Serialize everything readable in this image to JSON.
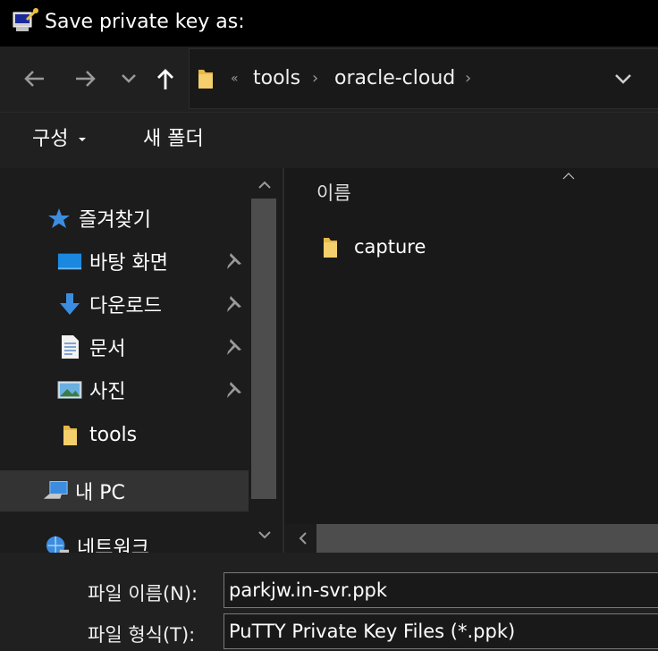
{
  "window": {
    "title": "Save private key as:",
    "app_icon": "putty-keygen-icon"
  },
  "nav": {
    "back_icon": "arrow-left-icon",
    "forward_icon": "arrow-right-icon",
    "recent_icon": "chevron-down-icon",
    "up_icon": "arrow-up-icon"
  },
  "address": {
    "overflow": "«",
    "crumbs": [
      "tools",
      "oracle-cloud"
    ],
    "separator": "›"
  },
  "commands": {
    "organize": "구성",
    "new_folder": "새 폴더"
  },
  "sidebar": {
    "items": [
      {
        "label": "즐겨찾기",
        "icon": "star-icon"
      },
      {
        "label": "바탕 화면",
        "icon": "desktop-icon",
        "pinned": true
      },
      {
        "label": "다운로드",
        "icon": "download-icon",
        "pinned": true
      },
      {
        "label": "문서",
        "icon": "document-icon",
        "pinned": true
      },
      {
        "label": "사진",
        "icon": "pictures-icon",
        "pinned": true
      },
      {
        "label": "tools",
        "icon": "folder-icon"
      },
      {
        "label": "내 PC",
        "icon": "computer-icon",
        "selected": true
      },
      {
        "label": "네트워크",
        "icon": "network-icon"
      }
    ]
  },
  "content": {
    "column_header": "이름",
    "items": [
      {
        "name": "capture",
        "icon": "folder-icon"
      }
    ]
  },
  "form": {
    "filename_label": "파일 이름(N):",
    "filename_value": "parkjw.in-svr.ppk",
    "filetype_label": "파일 형식(T):",
    "filetype_value": "PuTTY Private Key Files (*.ppk)"
  },
  "colors": {
    "background": "#202020",
    "folder": "#e8b84a",
    "accent": "#3c8de0"
  }
}
